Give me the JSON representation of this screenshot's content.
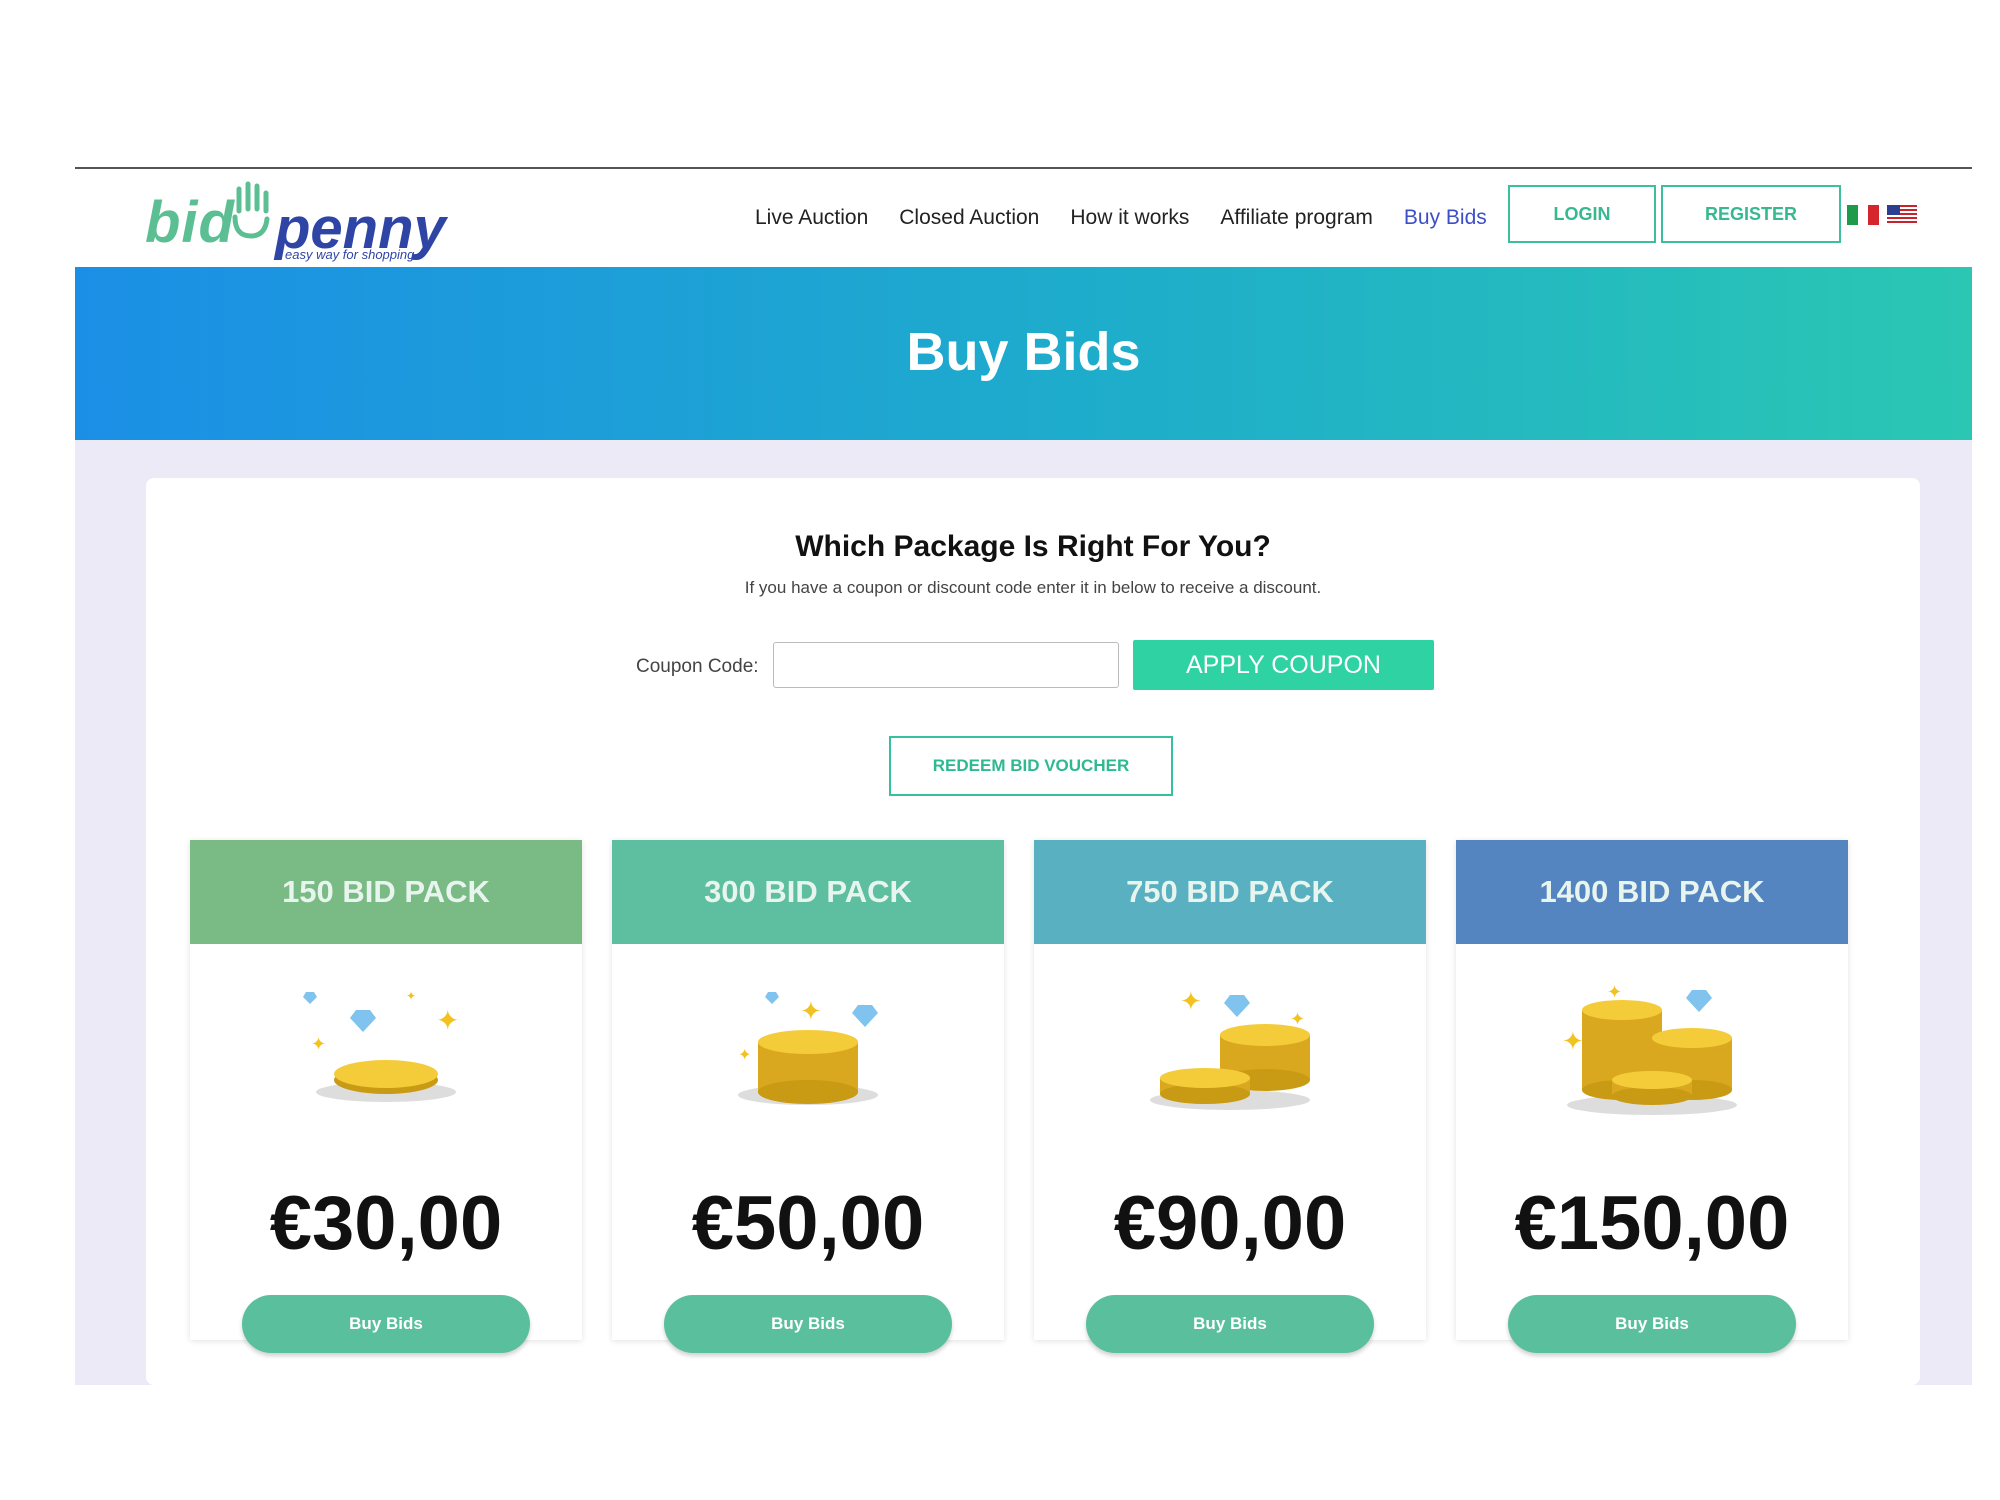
{
  "header": {
    "logo": {
      "word1": "bid",
      "word2": "penny",
      "tagline": "easy way for shopping"
    },
    "nav": [
      "Live Auction",
      "Closed Auction",
      "How it works",
      "Affiliate program",
      "Buy Bids"
    ],
    "active_nav": "Buy Bids",
    "login_label": "LOGIN",
    "register_label": "REGISTER",
    "flags": [
      "italy-flag-icon",
      "usa-flag-icon"
    ]
  },
  "banner": {
    "title": "Buy Bids"
  },
  "main": {
    "heading": "Which Package Is Right For You?",
    "subtext": "If you have a coupon or discount code enter it in below to receive a discount.",
    "coupon_label": "Coupon Code:",
    "coupon_value": "",
    "apply_label": "APPLY COUPON",
    "voucher_label": "REDEEM BID VOUCHER"
  },
  "packs": [
    {
      "title": "150 BID PACK",
      "price": "€30,00",
      "button": "Buy Bids",
      "color": "#7aba84",
      "image": "single-coin-icon"
    },
    {
      "title": "300 BID PACK",
      "price": "€50,00",
      "button": "Buy Bids",
      "color": "#5dbfa0",
      "image": "coin-stack-icon"
    },
    {
      "title": "750 BID PACK",
      "price": "€90,00",
      "button": "Buy Bids",
      "color": "#58b0c0",
      "image": "coin-stacks-icon"
    },
    {
      "title": "1400 BID PACK",
      "price": "€150,00",
      "button": "Buy Bids",
      "color": "#5585c0",
      "image": "coin-piles-icon"
    }
  ],
  "colors": {
    "accent": "#2fd3a3",
    "nav_active": "#3d4fc8",
    "banner_start": "#1b8fe6",
    "banner_end": "#2bc7b3"
  }
}
